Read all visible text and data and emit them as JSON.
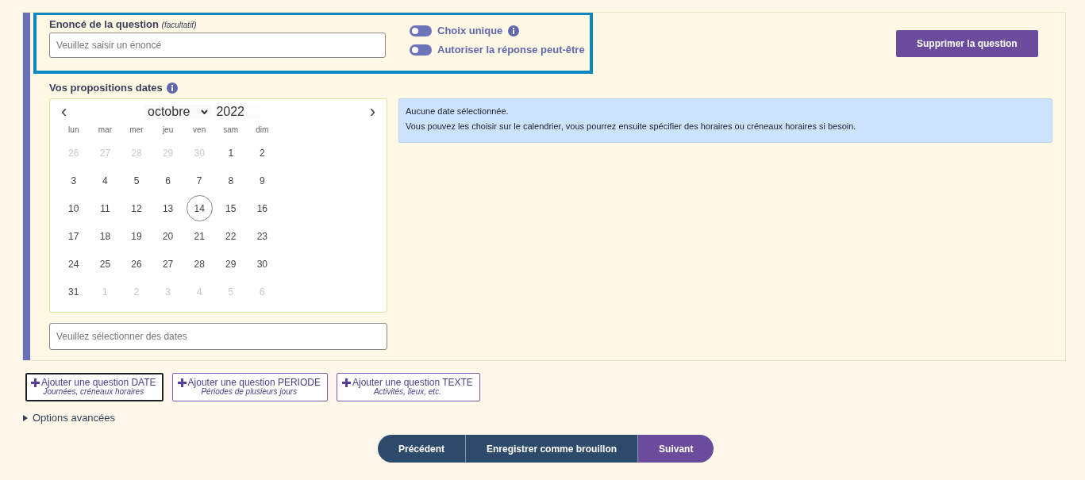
{
  "question": {
    "label": "Enoncé de la question",
    "label_note": "(facultatif)",
    "placeholder": "Veuillez saisir un énoncé",
    "toggles": [
      {
        "label": "Choix unique",
        "on": false,
        "info": true
      },
      {
        "label": "Autoriser la réponse peut-être",
        "on": false,
        "info": false
      }
    ],
    "delete_button": "Supprimer la question"
  },
  "dates": {
    "label": "Vos propositions dates",
    "prev": "‹",
    "next": "›",
    "month": "octobre",
    "year": "2022",
    "weekdays": [
      "lun",
      "mar",
      "mer",
      "jeu",
      "ven",
      "sam",
      "dim"
    ],
    "weeks": [
      [
        {
          "label": "26",
          "muted": true,
          "today": false
        },
        {
          "label": "27",
          "muted": true,
          "today": false
        },
        {
          "label": "28",
          "muted": true,
          "today": false
        },
        {
          "label": "29",
          "muted": true,
          "today": false
        },
        {
          "label": "30",
          "muted": true,
          "today": false
        },
        {
          "label": "1",
          "muted": false,
          "today": false
        },
        {
          "label": "2",
          "muted": false,
          "today": false
        }
      ],
      [
        {
          "label": "3",
          "muted": false,
          "today": false
        },
        {
          "label": "4",
          "muted": false,
          "today": false
        },
        {
          "label": "5",
          "muted": false,
          "today": false
        },
        {
          "label": "6",
          "muted": false,
          "today": false
        },
        {
          "label": "7",
          "muted": false,
          "today": false
        },
        {
          "label": "8",
          "muted": false,
          "today": false
        },
        {
          "label": "9",
          "muted": false,
          "today": false
        }
      ],
      [
        {
          "label": "10",
          "muted": false,
          "today": false
        },
        {
          "label": "11",
          "muted": false,
          "today": false
        },
        {
          "label": "12",
          "muted": false,
          "today": false
        },
        {
          "label": "13",
          "muted": false,
          "today": false
        },
        {
          "label": "14",
          "muted": false,
          "today": true
        },
        {
          "label": "15",
          "muted": false,
          "today": false
        },
        {
          "label": "16",
          "muted": false,
          "today": false
        }
      ],
      [
        {
          "label": "17",
          "muted": false,
          "today": false
        },
        {
          "label": "18",
          "muted": false,
          "today": false
        },
        {
          "label": "19",
          "muted": false,
          "today": false
        },
        {
          "label": "20",
          "muted": false,
          "today": false
        },
        {
          "label": "21",
          "muted": false,
          "today": false
        },
        {
          "label": "22",
          "muted": false,
          "today": false
        },
        {
          "label": "23",
          "muted": false,
          "today": false
        }
      ],
      [
        {
          "label": "24",
          "muted": false,
          "today": false
        },
        {
          "label": "25",
          "muted": false,
          "today": false
        },
        {
          "label": "26",
          "muted": false,
          "today": false
        },
        {
          "label": "27",
          "muted": false,
          "today": false
        },
        {
          "label": "28",
          "muted": false,
          "today": false
        },
        {
          "label": "29",
          "muted": false,
          "today": false
        },
        {
          "label": "30",
          "muted": false,
          "today": false
        }
      ],
      [
        {
          "label": "31",
          "muted": false,
          "today": false
        },
        {
          "label": "1",
          "muted": true,
          "today": false
        },
        {
          "label": "2",
          "muted": true,
          "today": false
        },
        {
          "label": "3",
          "muted": true,
          "today": false
        },
        {
          "label": "4",
          "muted": true,
          "today": false
        },
        {
          "label": "5",
          "muted": true,
          "today": false
        },
        {
          "label": "6",
          "muted": true,
          "today": false
        }
      ]
    ],
    "dates_placeholder": "Veuillez sélectionner des dates",
    "notice": [
      "Aucune date sélectionnée.",
      "Vous pouvez les choisir sur le calendrier, vous pourrez ensuite spécifier des horaires ou créneaux horaires si besoin."
    ]
  },
  "add_buttons": [
    {
      "title": "Ajouter une question DATE",
      "subtitle": "Journées, créneaux horaires",
      "focused": true
    },
    {
      "title": "Ajouter une question PERIODE",
      "subtitle": "Périodes de plusieurs jours",
      "focused": false
    },
    {
      "title": "Ajouter une question TEXTE",
      "subtitle": "Activités, lieux, etc.",
      "focused": false
    }
  ],
  "advanced_options": {
    "label": "Options avancées",
    "expanded": false
  },
  "nav_buttons": [
    {
      "label": "Précédent",
      "kind": "secondary"
    },
    {
      "label": "Enregistrer comme brouillon",
      "kind": "secondary"
    },
    {
      "label": "Suivant",
      "kind": "primary"
    }
  ]
}
